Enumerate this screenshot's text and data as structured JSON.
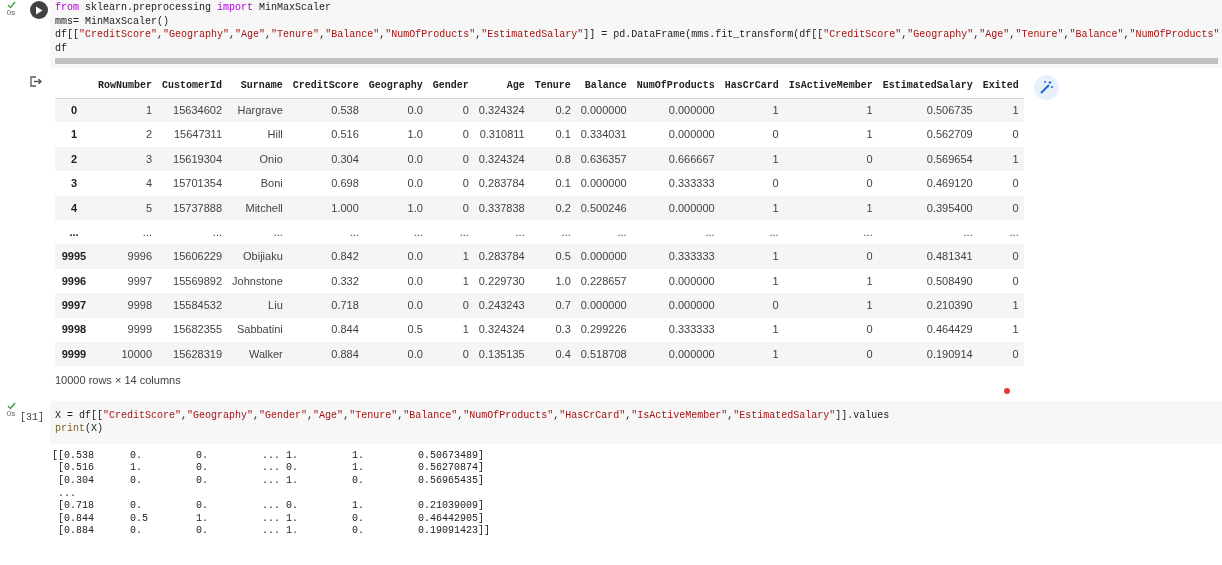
{
  "cells": [
    {
      "run_button": true,
      "time": "0s",
      "lines": [
        [
          {
            "kind": "kw",
            "text": "from"
          },
          {
            "kind": "p",
            "text": " sklearn.preprocessing "
          },
          {
            "kind": "kw",
            "text": "import"
          },
          {
            "kind": "p",
            "text": " MinMaxScaler"
          }
        ],
        [
          {
            "kind": "p",
            "text": "mms= MinMaxScaler()"
          }
        ],
        [
          {
            "kind": "p",
            "text": "df[["
          },
          {
            "kind": "s",
            "text": "\"CreditScore\""
          },
          {
            "kind": "p",
            "text": ","
          },
          {
            "kind": "s",
            "text": "\"Geography\""
          },
          {
            "kind": "p",
            "text": ","
          },
          {
            "kind": "s",
            "text": "\"Age\""
          },
          {
            "kind": "p",
            "text": ","
          },
          {
            "kind": "s",
            "text": "\"Tenure\""
          },
          {
            "kind": "p",
            "text": ","
          },
          {
            "kind": "s",
            "text": "\"Balance\""
          },
          {
            "kind": "p",
            "text": ","
          },
          {
            "kind": "s",
            "text": "\"NumOfProducts\""
          },
          {
            "kind": "p",
            "text": ","
          },
          {
            "kind": "s",
            "text": "\"EstimatedSalary\""
          },
          {
            "kind": "p",
            "text": "]] = pd.DataFrame(mms.fit_transform(df[["
          },
          {
            "kind": "s",
            "text": "\"CreditScore\""
          },
          {
            "kind": "p",
            "text": ","
          },
          {
            "kind": "s",
            "text": "\"Geography\""
          },
          {
            "kind": "p",
            "text": ","
          },
          {
            "kind": "s",
            "text": "\"Age\""
          },
          {
            "kind": "p",
            "text": ","
          },
          {
            "kind": "s",
            "text": "\"Tenure\""
          },
          {
            "kind": "p",
            "text": ","
          },
          {
            "kind": "s",
            "text": "\"Balance\""
          },
          {
            "kind": "p",
            "text": ","
          },
          {
            "kind": "s",
            "text": "\"NumOfProducts\""
          }
        ],
        [
          {
            "kind": "p",
            "text": "df"
          }
        ]
      ],
      "hscroll": true,
      "output": {
        "kind": "dataframe",
        "columns": [
          "RowNumber",
          "CustomerId",
          "Surname",
          "CreditScore",
          "Geography",
          "Gender",
          "Age",
          "Tenure",
          "Balance",
          "NumOfProducts",
          "HasCrCard",
          "IsActiveMember",
          "EstimatedSalary",
          "Exited"
        ],
        "rows": [
          {
            "index": "0",
            "cells": [
              "1",
              "15634602",
              "Hargrave",
              "0.538",
              "0.0",
              "0",
              "0.324324",
              "0.2",
              "0.000000",
              "0.000000",
              "1",
              "1",
              "0.506735",
              "1"
            ]
          },
          {
            "index": "1",
            "cells": [
              "2",
              "15647311",
              "Hill",
              "0.516",
              "1.0",
              "0",
              "0.310811",
              "0.1",
              "0.334031",
              "0.000000",
              "0",
              "1",
              "0.562709",
              "0"
            ]
          },
          {
            "index": "2",
            "cells": [
              "3",
              "15619304",
              "Onio",
              "0.304",
              "0.0",
              "0",
              "0.324324",
              "0.8",
              "0.636357",
              "0.666667",
              "1",
              "0",
              "0.569654",
              "1"
            ]
          },
          {
            "index": "3",
            "cells": [
              "4",
              "15701354",
              "Boni",
              "0.698",
              "0.0",
              "0",
              "0.283784",
              "0.1",
              "0.000000",
              "0.333333",
              "0",
              "0",
              "0.469120",
              "0"
            ]
          },
          {
            "index": "4",
            "cells": [
              "5",
              "15737888",
              "Mitchell",
              "1.000",
              "1.0",
              "0",
              "0.337838",
              "0.2",
              "0.500246",
              "0.000000",
              "1",
              "1",
              "0.395400",
              "0"
            ]
          },
          {
            "index": "...",
            "cells": [
              "...",
              "...",
              "...",
              "...",
              "...",
              "...",
              "...",
              "...",
              "...",
              "...",
              "...",
              "...",
              "...",
              "..."
            ]
          },
          {
            "index": "9995",
            "cells": [
              "9996",
              "15606229",
              "Obijiaku",
              "0.842",
              "0.0",
              "1",
              "0.283784",
              "0.5",
              "0.000000",
              "0.333333",
              "1",
              "0",
              "0.481341",
              "0"
            ]
          },
          {
            "index": "9996",
            "cells": [
              "9997",
              "15569892",
              "Johnstone",
              "0.332",
              "0.0",
              "1",
              "0.229730",
              "1.0",
              "0.228657",
              "0.000000",
              "1",
              "1",
              "0.508490",
              "0"
            ]
          },
          {
            "index": "9997",
            "cells": [
              "9998",
              "15584532",
              "Liu",
              "0.718",
              "0.0",
              "0",
              "0.243243",
              "0.7",
              "0.000000",
              "0.000000",
              "0",
              "1",
              "0.210390",
              "1"
            ]
          },
          {
            "index": "9998",
            "cells": [
              "9999",
              "15682355",
              "Sabbatini",
              "0.844",
              "0.5",
              "1",
              "0.324324",
              "0.3",
              "0.299226",
              "0.333333",
              "1",
              "0",
              "0.464429",
              "1"
            ]
          },
          {
            "index": "9999",
            "cells": [
              "10000",
              "15628319",
              "Walker",
              "0.884",
              "0.0",
              "0",
              "0.135135",
              "0.4",
              "0.518708",
              "0.000000",
              "1",
              "0",
              "0.190914",
              "0"
            ]
          }
        ],
        "summary": "10000 rows × 14 columns"
      }
    },
    {
      "run_button": false,
      "count": "[31]",
      "time": "0s",
      "lines": [
        [
          {
            "kind": "p",
            "text": "X = df[["
          },
          {
            "kind": "s",
            "text": "\"CreditScore\""
          },
          {
            "kind": "p",
            "text": ","
          },
          {
            "kind": "s",
            "text": "\"Geography\""
          },
          {
            "kind": "p",
            "text": ","
          },
          {
            "kind": "s",
            "text": "\"Gender\""
          },
          {
            "kind": "p",
            "text": ","
          },
          {
            "kind": "s",
            "text": "\"Age\""
          },
          {
            "kind": "p",
            "text": ","
          },
          {
            "kind": "s",
            "text": "\"Tenure\""
          },
          {
            "kind": "p",
            "text": ","
          },
          {
            "kind": "s",
            "text": "\"Balance\""
          },
          {
            "kind": "p",
            "text": ","
          },
          {
            "kind": "s",
            "text": "\"NumOfProducts\""
          },
          {
            "kind": "p",
            "text": ","
          },
          {
            "kind": "s",
            "text": "\"HasCrCard\""
          },
          {
            "kind": "p",
            "text": ","
          },
          {
            "kind": "s",
            "text": "\"IsActiveMember\""
          },
          {
            "kind": "p",
            "text": ","
          },
          {
            "kind": "s",
            "text": "\"EstimatedSalary\""
          },
          {
            "kind": "p",
            "text": "]].values"
          }
        ],
        [
          {
            "kind": "fn",
            "text": "print"
          },
          {
            "kind": "p",
            "text": "(X)"
          }
        ]
      ],
      "hscroll": false,
      "output": {
        "kind": "stream",
        "lines": [
          "[[0.538      0.         0.         ... 1.         1.         0.50673489]",
          " [0.516      1.         0.         ... 0.         1.         0.56270874]",
          " [0.304      0.         0.         ... 1.         0.         0.56965435]",
          " ...",
          " [0.718      0.         0.         ... 0.         1.         0.21039009]",
          " [0.844      0.5        1.         ... 1.         0.         0.46442905]",
          " [0.884      0.         0.         ... 1.         0.         0.19091423]]"
        ]
      }
    }
  ]
}
